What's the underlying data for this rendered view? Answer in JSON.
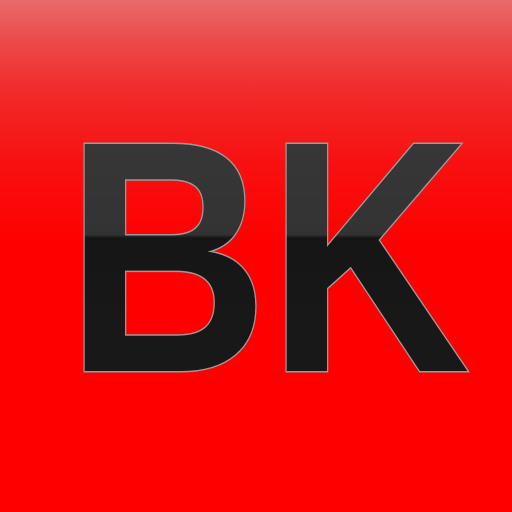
{
  "icon": {
    "monogram": "BK",
    "colors": {
      "background_top": "#e96b6b",
      "background_main": "#ff0000",
      "letter_fill": "#1a1a1a",
      "letter_outline": "#9a9a9a",
      "letter_highlight": "#3a3a3a"
    }
  }
}
